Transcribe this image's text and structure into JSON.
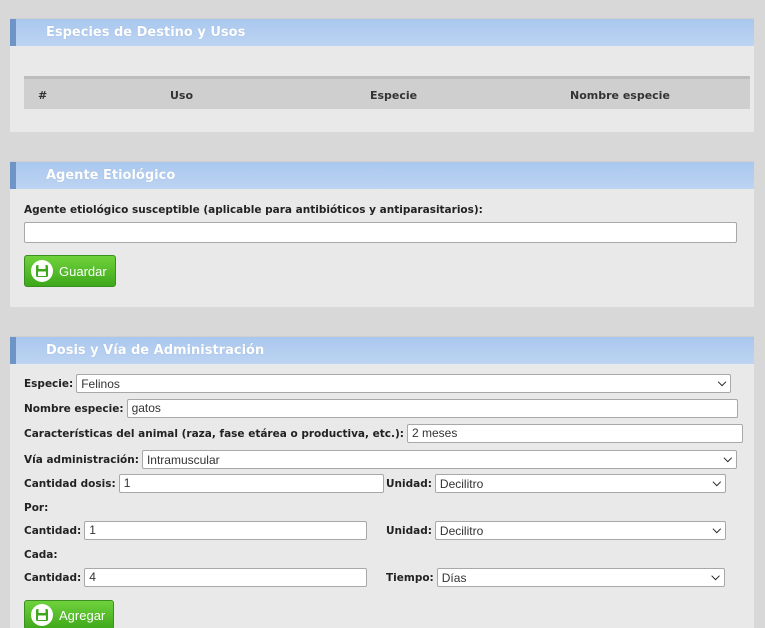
{
  "especies": {
    "title": "Especies de Destino y Usos",
    "columns": [
      "#",
      "Uso",
      "Especie",
      "Nombre especie"
    ]
  },
  "agente": {
    "title": "Agente Etiológico",
    "label": "Agente etiológico susceptible (aplicable para antibióticos y antiparasitarios):",
    "value": "",
    "save_label": "Guardar"
  },
  "dosis": {
    "title": "Dosis y Vía de Administración",
    "especie_label": "Especie:",
    "especie_value": "Felinos",
    "nombre_label": "Nombre especie:",
    "nombre_value": "gatos",
    "caracteristicas_label": "Características del animal (raza, fase etárea o productiva, etc.):",
    "caracteristicas_value": "2 meses",
    "via_label": "Vía administración:",
    "via_value": "Intramuscular",
    "cantidad_dosis_label": "Cantidad dosis:",
    "cantidad_dosis_value": "1",
    "unidad_label": "Unidad:",
    "unidad1_value": "Decilitro",
    "por_label": "Por:",
    "cantidad_label": "Cantidad:",
    "cantidad_por_value": "1",
    "unidad2_value": "Decilitro",
    "cada_label": "Cada:",
    "cantidad_cada_value": "4",
    "tiempo_label": "Tiempo:",
    "tiempo_value": "Días",
    "add_label": "Agregar"
  },
  "colors": {
    "header_bg": "#bdd4f2",
    "header_accent": "#6f94c7",
    "button_green": "#3ea81a"
  },
  "icons": {
    "save": "floppy-disk-icon",
    "dropdown": "chevron-down-icon"
  }
}
